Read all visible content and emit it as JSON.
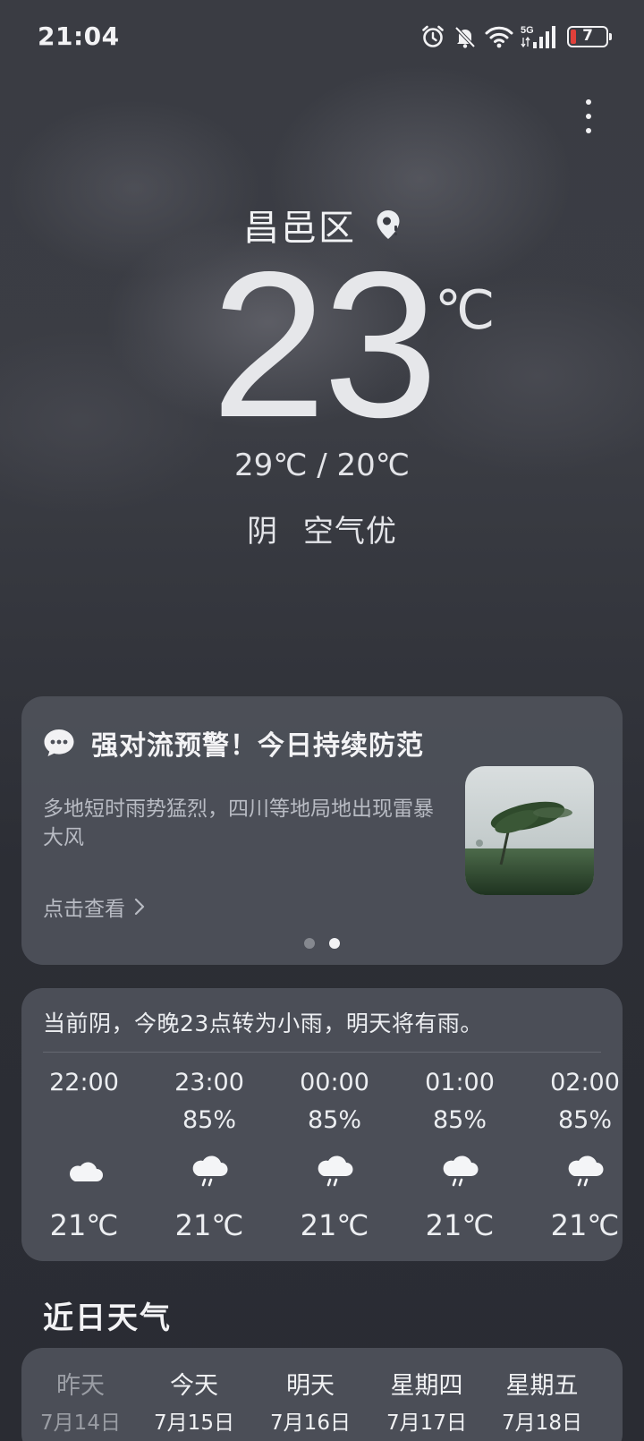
{
  "status_bar": {
    "time": "21:04",
    "network_label": "5G",
    "battery": "7",
    "icons": [
      "alarm-icon",
      "silent-bell-icon",
      "wifi-icon",
      "signal-icon",
      "battery-icon"
    ],
    "battery_color": "#e0403a"
  },
  "header": {
    "location": "昌邑区",
    "location_icon": "location-pin-icon",
    "temperature": "23",
    "unit": "℃",
    "high_low": "29℃ / 20℃",
    "condition": "阴",
    "air_quality": "空气优"
  },
  "alert": {
    "title": "强对流预警！今日持续防范",
    "description": "多地短时雨势猛烈，四川等地局地出现雷暴大风",
    "link": "点击查看",
    "page_count": 2,
    "active_page": 2
  },
  "hourly": {
    "summary": "当前阴，今晚23点转为小雨，明天将有雨。",
    "items": [
      {
        "time": "22:00",
        "precip": "",
        "icon": "cloud-icon",
        "temp": "21℃"
      },
      {
        "time": "23:00",
        "precip": "85%",
        "icon": "light-rain-icon",
        "temp": "21℃"
      },
      {
        "time": "00:00",
        "precip": "85%",
        "icon": "light-rain-icon",
        "temp": "21℃"
      },
      {
        "time": "01:00",
        "precip": "85%",
        "icon": "light-rain-icon",
        "temp": "21℃"
      },
      {
        "time": "02:00",
        "precip": "85%",
        "icon": "light-rain-icon",
        "temp": "21℃"
      }
    ]
  },
  "daily": {
    "title": "近日天气",
    "days": [
      {
        "name": "昨天",
        "date": "7月14日"
      },
      {
        "name": "今天",
        "date": "7月15日"
      },
      {
        "name": "明天",
        "date": "7月16日"
      },
      {
        "name": "星期四",
        "date": "7月17日"
      },
      {
        "name": "星期五",
        "date": "7月18日"
      }
    ]
  }
}
